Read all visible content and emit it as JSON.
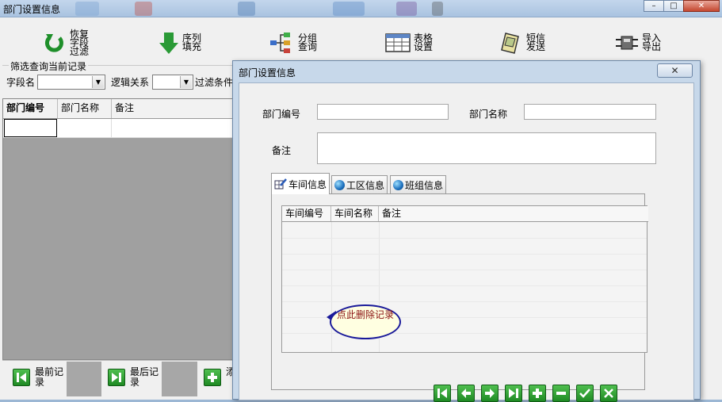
{
  "main_window": {
    "title": "部门设置信息",
    "controls": {
      "minimize": "–",
      "maximize": "□",
      "close": "✕"
    }
  },
  "toolbar": {
    "items": [
      {
        "label": "恢复字段过滤",
        "icon": "green-undo-arrow-icon"
      },
      {
        "label": "序列填充",
        "icon": "green-down-arrow-icon"
      },
      {
        "label": "分组查询",
        "icon": "group-tree-icon"
      },
      {
        "label": "表格设置",
        "icon": "table-settings-icon"
      },
      {
        "label": "短信发送",
        "icon": "sms-phone-icon"
      },
      {
        "label": "导入导出",
        "icon": "import-export-icon"
      }
    ]
  },
  "filter": {
    "legend": "筛选查询当前记录",
    "field_name_label": "字段名",
    "field_name_value": "",
    "logic_label": "逻辑关系",
    "logic_value": "",
    "condition_label": "过滤条件"
  },
  "main_grid": {
    "columns": [
      "部门编号",
      "部门名称",
      "备注"
    ],
    "rows": [
      [
        "",
        "",
        ""
      ]
    ]
  },
  "main_nav": {
    "first_label": "最前记录",
    "last_label": "最后记录",
    "add_partial_label": "添"
  },
  "dialog": {
    "title": "部门设置信息",
    "close": "✕",
    "dept_code_label": "部门编号",
    "dept_code_value": "",
    "dept_name_label": "部门名称",
    "dept_name_value": "",
    "remark_label": "备注",
    "remark_value": "",
    "tabs": [
      {
        "label": "车间信息",
        "icon": "pencil-grid-icon",
        "active": true
      },
      {
        "label": "工区信息",
        "icon": "globe-icon",
        "active": false
      },
      {
        "label": "班组信息",
        "icon": "globe-icon",
        "active": false
      }
    ],
    "detail_grid": {
      "columns": [
        "车间编号",
        "车间名称",
        "备注"
      ],
      "rows": []
    },
    "nav_buttons": [
      "first",
      "prev",
      "next",
      "last",
      "add",
      "delete",
      "save",
      "cancel"
    ],
    "tooltip": "点此删除记录"
  },
  "colors": {
    "titlebar": "#a9c3e0",
    "grid_empty": "#a0a0a0",
    "nav_green": "#1f8a24",
    "tooltip_border": "#1a1a9a",
    "tooltip_text": "#8a1010"
  }
}
